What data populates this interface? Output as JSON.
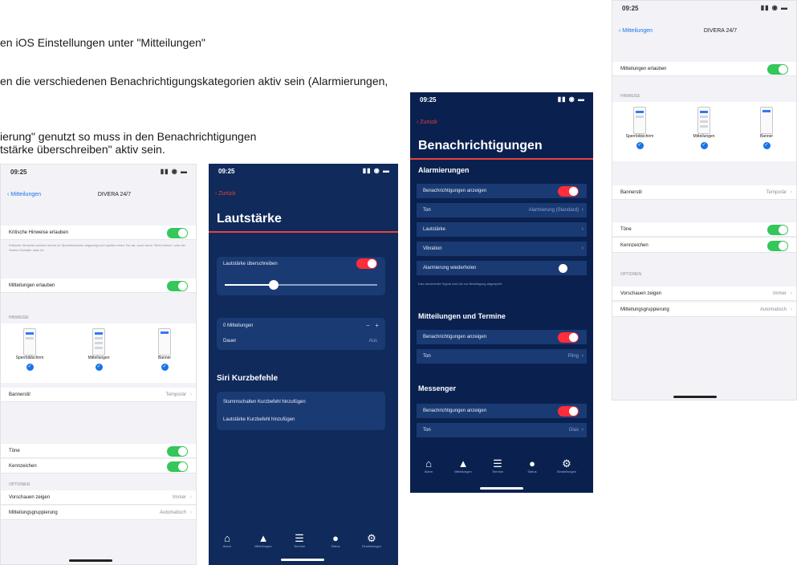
{
  "doc": {
    "line1": "en iOS Einstellungen unter \"Mitteilungen\"",
    "line2": "en die verschiedenen Benachrichtigungskategorien aktiv sein (Alarmierungen,",
    "line3": "ierung\" genutzt so muss in den Benachrichtigungen",
    "line4": "tstärke überschreiben\" aktiv sein."
  },
  "status": {
    "time": "09:25",
    "signal": "▮▮ ◉ ▬"
  },
  "p1": {
    "back": "‹ Mitteilungen",
    "title": "DIVERA 24/7",
    "critical_label": "Kritische Hinweise erlauben",
    "critical_note": "Kritische Hinweise werden immer im Sperrbildschirm angezeigt und spielen einen Ton ab, auch wenn \"Nicht stören\" oder der Stumm-Schalter aktiv ist.",
    "allow_label": "Mitteilungen erlauben",
    "section_hinweise": "Hinweise",
    "tile1": "Sperrbildschirm",
    "tile2": "Mitteilungen",
    "tile3": "Banner",
    "banner_label": "Bannerstil",
    "banner_value": "Temporär",
    "sounds_label": "Töne",
    "badge_label": "Kennzeichen",
    "section_options": "Optionen",
    "preview_label": "Vorschauen zeigen",
    "preview_value": "Immer",
    "grouping_label": "Mitteilungsgruppierung",
    "grouping_value": "Automatisch"
  },
  "p2": {
    "back": "‹ Zurück",
    "title": "Lautstärke",
    "override_label": "Lautstärke überschreiben",
    "slider_value": 0.32,
    "notify_label": "0 Mitteilungen",
    "minus": "−",
    "plus": "+",
    "duration_label": "Dauer",
    "duration_value": "Aus",
    "siri_head": "Siri Kurzbefehle",
    "siri_row1": "Stummschalten Kurzbefehl hinzufügen",
    "siri_row2": "Lautstärke Kurzbefehl hinzufügen"
  },
  "p3": {
    "back": "‹ Zurück",
    "title": "Benachrichtigungen",
    "alarm_head": "Alarmierungen",
    "show_label": "Benachrichtigungen anzeigen",
    "tone_label": "Ton",
    "tone_value": "Alarmierung (Standard)",
    "volume_label": "Lautstärke",
    "vibrate_label": "Vibration",
    "repeat_label": "Alarmierung wiederholen",
    "alarm_note": "Das wiederholte Signal wird bis zur Bestätigung abgespielt.",
    "msg_head": "Mitteilungen und Termine",
    "show2_label": "Benachrichtigungen anzeigen",
    "tone2_label": "Ton",
    "tone2_value": "Pling",
    "messenger_head": "Messenger",
    "show3_label": "Benachrichtigungen anzeigen",
    "tone3_label": "Ton",
    "tone3_value": "Glas"
  },
  "p4": {
    "back": "‹ Mitteilungen",
    "title": "DIVERA 24/7",
    "allow_label": "Mitteilungen erlauben",
    "section_hinweise": "Hinweise",
    "tile1": "Sperrbildschirm",
    "tile2": "Mitteilungen",
    "tile3": "Banner",
    "banner_label": "Bannerstil",
    "banner_value": "Temporär",
    "sounds_label": "Töne",
    "badge_label": "Kennzeichen",
    "section_options": "Optionen",
    "preview_label": "Vorschauen zeigen",
    "preview_value": "Immer",
    "grouping_label": "Mitteilungsgruppierung",
    "grouping_value": "Automatisch"
  },
  "tabs": [
    {
      "icon": "⌂",
      "label": "Alarm"
    },
    {
      "icon": "▲",
      "label": "Mitteilungen"
    },
    {
      "icon": "☰",
      "label": "Termine"
    },
    {
      "icon": "●",
      "label": "Status"
    },
    {
      "icon": "⚙",
      "label": "Einstellungen"
    }
  ]
}
